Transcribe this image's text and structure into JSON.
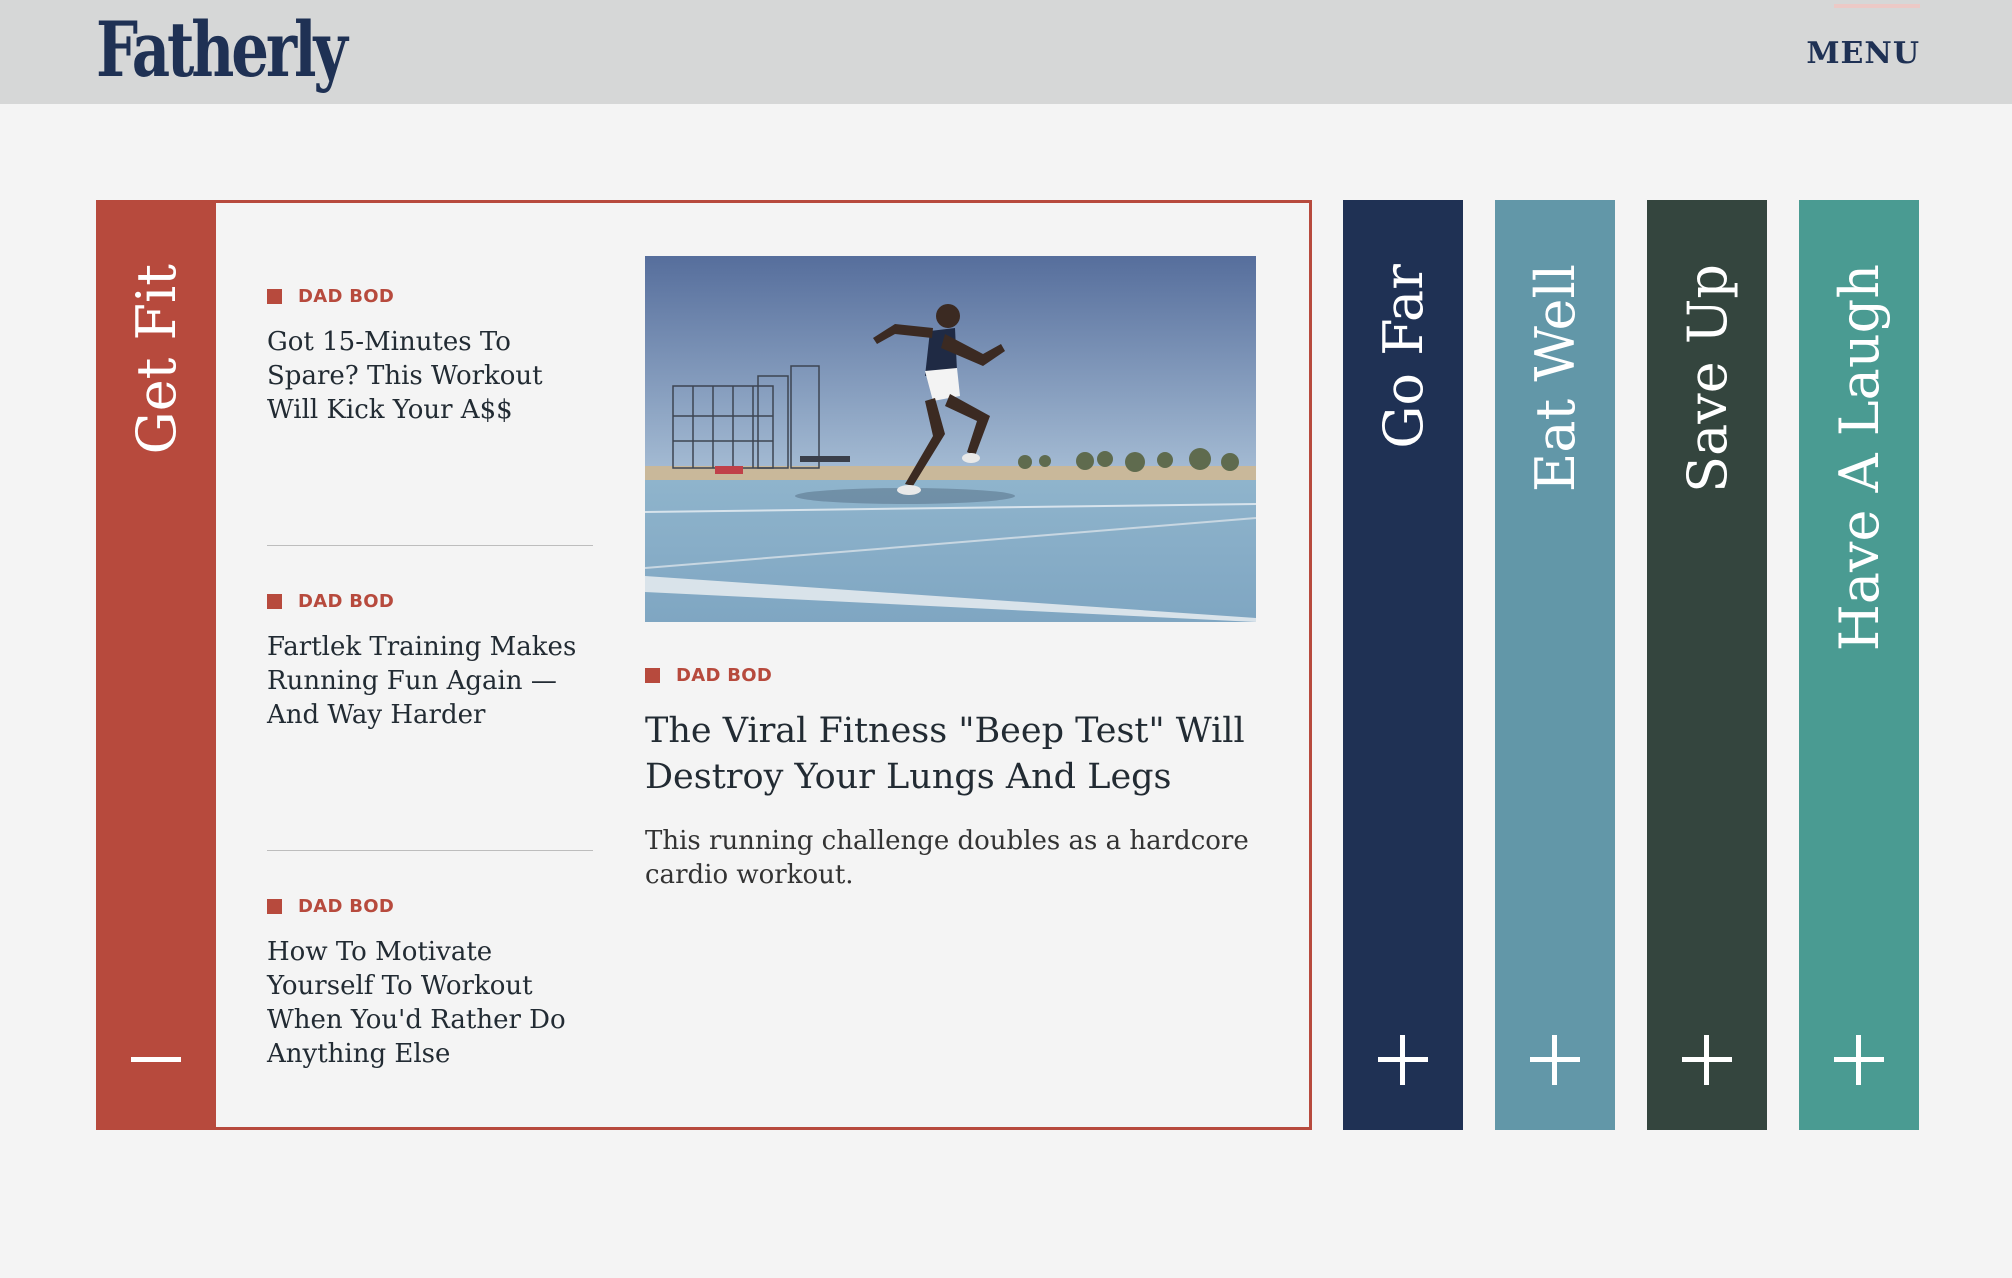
{
  "header": {
    "logo": "Fatherly",
    "menu_label": "MENU"
  },
  "sections": {
    "open": {
      "label": "Get Fit",
      "toggle_icon": "minus-icon",
      "color": "#b74a3d"
    },
    "collapsed": [
      {
        "label": "Go Far",
        "toggle_icon": "plus-icon",
        "color": "#1f3154"
      },
      {
        "label": "Eat Well",
        "toggle_icon": "plus-icon",
        "color": "#6297a8"
      },
      {
        "label": "Save Up",
        "toggle_icon": "plus-icon",
        "color": "#34453e"
      },
      {
        "label": "Have A Laugh",
        "toggle_icon": "plus-icon",
        "color": "#4a9b92"
      }
    ]
  },
  "articles": [
    {
      "tag": "DAD BOD",
      "title": "Got 15-Minutes To Spare? This Workout Will Kick Your A$$"
    },
    {
      "tag": "DAD BOD",
      "title": "Fartlek Training Makes Running Fun Again — And Way Harder"
    },
    {
      "tag": "DAD BOD",
      "title": "How To Motivate Yourself To Workout When You'd Rather Do Anything Else"
    }
  ],
  "feature": {
    "tag": "DAD BOD",
    "title": "The Viral Fitness \"Beep Test\" Will Destroy Your Lungs And Legs",
    "description": "This running challenge doubles as a hardcore cardio workout.",
    "image_icon": "runner-on-track-photo"
  },
  "colors": {
    "brand_navy": "#1f3154",
    "accent_red": "#b74a3d",
    "header_bg": "#d6d7d7",
    "page_bg": "#f4f4f4"
  }
}
